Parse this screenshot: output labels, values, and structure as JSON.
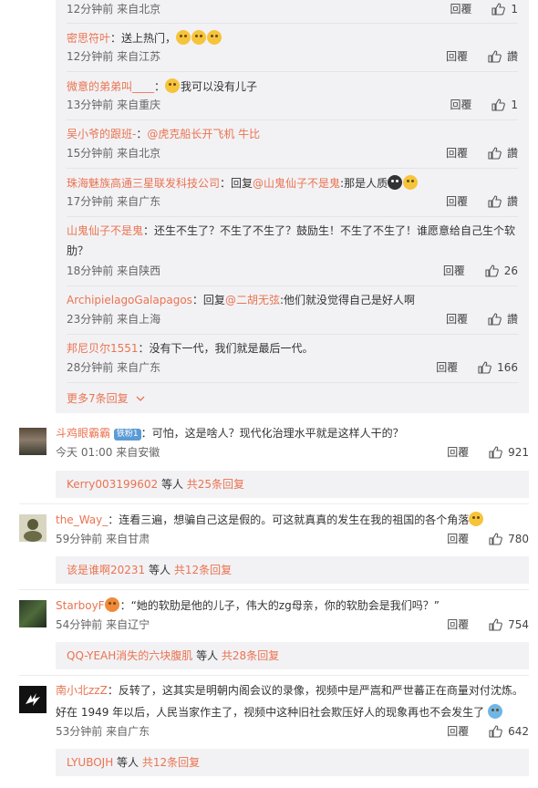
{
  "sub_replies": [
    {
      "user": "",
      "content": "",
      "time": "12分钟前 来自北京",
      "likes": "1"
    },
    {
      "user": "密思符叶",
      "content": "：送上热门，",
      "time": "12分钟前 来自江苏",
      "likes": "讚"
    },
    {
      "user": "微意的弟弟叫____",
      "content": "我可以没有儿子",
      "time": "13分钟前 来自重庆",
      "likes": "1"
    },
    {
      "user": "吴小爷的跟班-",
      "content": "@虎克船长开飞机 牛比",
      "time": "15分钟前 来自北京",
      "likes": "讚"
    },
    {
      "user": "珠海魅族高通三星联发科技公司",
      "content_pre": "：回复",
      "at": "@山鬼仙子不是鬼",
      "content": ":那是人质",
      "time": "17分钟前 来自广东",
      "likes": "讚"
    },
    {
      "user": "山鬼仙子不是鬼",
      "content": "：还生不生了？不生了不生了？鼓励生！不生了不生了！谁愿意给自己生个软",
      "content2": "肋？",
      "time": "18分钟前 来自陕西",
      "likes": "26"
    },
    {
      "user": "ArchipielagoGalapagos",
      "content_pre": "：回复",
      "at": "@二胡无弦",
      "content": ":他们就没觉得自己是好人啊",
      "time": "23分钟前 来自上海",
      "likes": "讚"
    },
    {
      "user": "邦尼贝尔1551",
      "content": "：没有下一代，我们就是最后一代。",
      "time": "28分钟前 来自广东",
      "likes": "166"
    }
  ],
  "more_replies": "更多7条回复",
  "reply_label": "回覆",
  "main_comments": [
    {
      "user": "斗鸡眼霸霸",
      "badge": "铁粉1",
      "content": "：可怕，这是啥人？现代化治理水平就是这样人干的？",
      "time": "今天 01:00 来自安徽",
      "likes": "921",
      "foot_user": "Kerry003199602",
      "foot_mid": " 等人 ",
      "foot_count": "共25条回复"
    },
    {
      "user": "the_Way_",
      "content": "：连看三遍，想骗自己这是假的。可这就真真的发生在我的祖国的各个角落",
      "time": "59分钟前 来自甘肃",
      "likes": "780",
      "foot_user": "该是谁啊20231",
      "foot_mid": " 等人 ",
      "foot_count": "共12条回复"
    },
    {
      "user": "StarboyF",
      "content": "：“她的软肋是他的儿子，伟大的zg母亲，你的软肋会是我们吗？”",
      "time": "54分钟前 来自辽宁",
      "likes": "754",
      "foot_user": "QQ-YEAH消失的六块腹肌",
      "foot_mid": " 等人 ",
      "foot_count": "共28条回复"
    },
    {
      "user": "南小北zzZ",
      "content": "：反转了，这其实是明朝内阁会议的录像，视频中是严嵩和严世蕃正在商量对付沈炼。",
      "content2": "好在 1949 年以后，人民当家作主了，视频中这种旧社会欺压好人的现象再也不会发生了",
      "time": "53分钟前 来自广东",
      "likes": "642",
      "foot_user": "LYUBOJH",
      "foot_mid": " 等人 ",
      "foot_count": "共12条回复"
    }
  ],
  "colors": {
    "accent": "#eb7350",
    "reply_bg": "#f2f2f5"
  }
}
